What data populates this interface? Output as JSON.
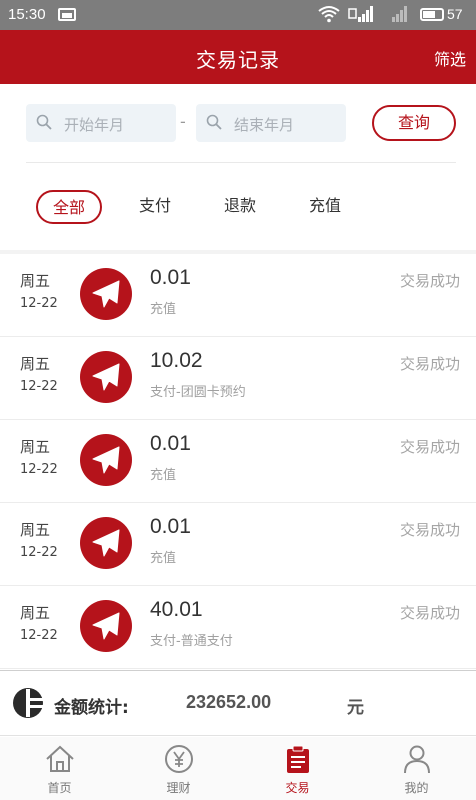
{
  "status_bar": {
    "time": "15:30",
    "battery": "57"
  },
  "header": {
    "title": "交易记录",
    "filter": "筛选"
  },
  "search": {
    "start_placeholder": "开始年月",
    "end_placeholder": "结束年月",
    "separator": "-",
    "query_button": "查询"
  },
  "tabs": [
    {
      "label": "全部",
      "active": true
    },
    {
      "label": "支付",
      "active": false
    },
    {
      "label": "退款",
      "active": false
    },
    {
      "label": "充值",
      "active": false
    }
  ],
  "transactions": [
    {
      "weekday": "周五",
      "date": "12-22",
      "amount": "0.01",
      "type": "充值",
      "status": "交易成功"
    },
    {
      "weekday": "周五",
      "date": "12-22",
      "amount": "10.02",
      "type": "支付-团圆卡预约",
      "status": "交易成功"
    },
    {
      "weekday": "周五",
      "date": "12-22",
      "amount": "0.01",
      "type": "充值",
      "status": "交易成功"
    },
    {
      "weekday": "周五",
      "date": "12-22",
      "amount": "0.01",
      "type": "充值",
      "status": "交易成功"
    },
    {
      "weekday": "周五",
      "date": "12-22",
      "amount": "40.01",
      "type": "支付-普通支付",
      "status": "交易成功"
    }
  ],
  "summary": {
    "label": "金额统计:",
    "total": "232652.00",
    "unit": "元"
  },
  "nav": [
    {
      "label": "首页",
      "icon": "home-icon",
      "active": false
    },
    {
      "label": "理财",
      "icon": "yen-icon",
      "active": false
    },
    {
      "label": "交易",
      "icon": "clipboard-icon",
      "active": true
    },
    {
      "label": "我的",
      "icon": "user-icon",
      "active": false
    }
  ],
  "colors": {
    "brand": "#b5131b",
    "status_bar": "#7d7d7d"
  }
}
